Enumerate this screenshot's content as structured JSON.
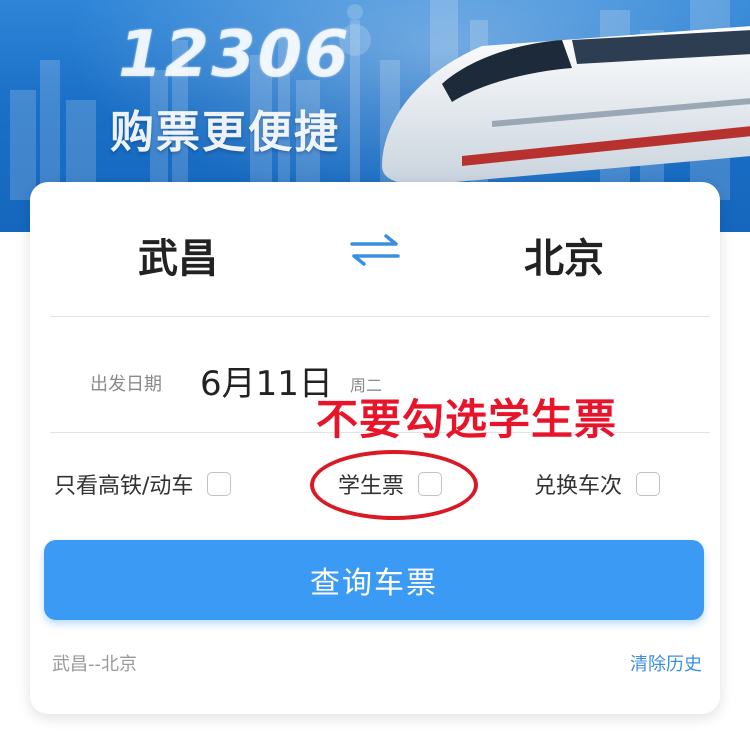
{
  "banner": {
    "number": "12306",
    "slogan": "购票更便捷"
  },
  "route": {
    "from": "武昌",
    "to": "北京"
  },
  "date": {
    "label": "出发日期",
    "value": "6月11日",
    "weekday": "周二"
  },
  "annotation": "不要勾选学生票",
  "options": [
    {
      "label": "只看高铁/动车",
      "checked": false
    },
    {
      "label": "学生票",
      "checked": false
    },
    {
      "label": "兑换车次",
      "checked": false
    }
  ],
  "search_button": "查询车票",
  "history": {
    "item": "武昌--北京",
    "clear_label": "清除历史"
  },
  "colors": {
    "accent": "#3b9af4",
    "annotation_red": "#e8142a",
    "link": "#3b8fe3"
  }
}
